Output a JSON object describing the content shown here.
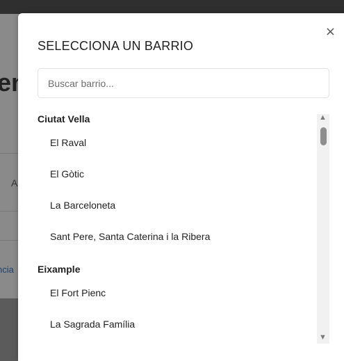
{
  "background": {
    "heading": "en",
    "letter": "A",
    "link": "ncia"
  },
  "modal": {
    "title": "SELECCIONA UN BARRIO",
    "close_icon": "×",
    "search_placeholder": "Buscar barrio...",
    "groups": [
      {
        "name": "Ciutat Vella",
        "items": [
          "El Raval",
          "El Gòtic",
          "La Barceloneta",
          "Sant Pere, Santa Caterina i la Ribera"
        ]
      },
      {
        "name": "Eixample",
        "items": [
          "El Fort Pienc",
          "La Sagrada Família"
        ]
      }
    ]
  }
}
